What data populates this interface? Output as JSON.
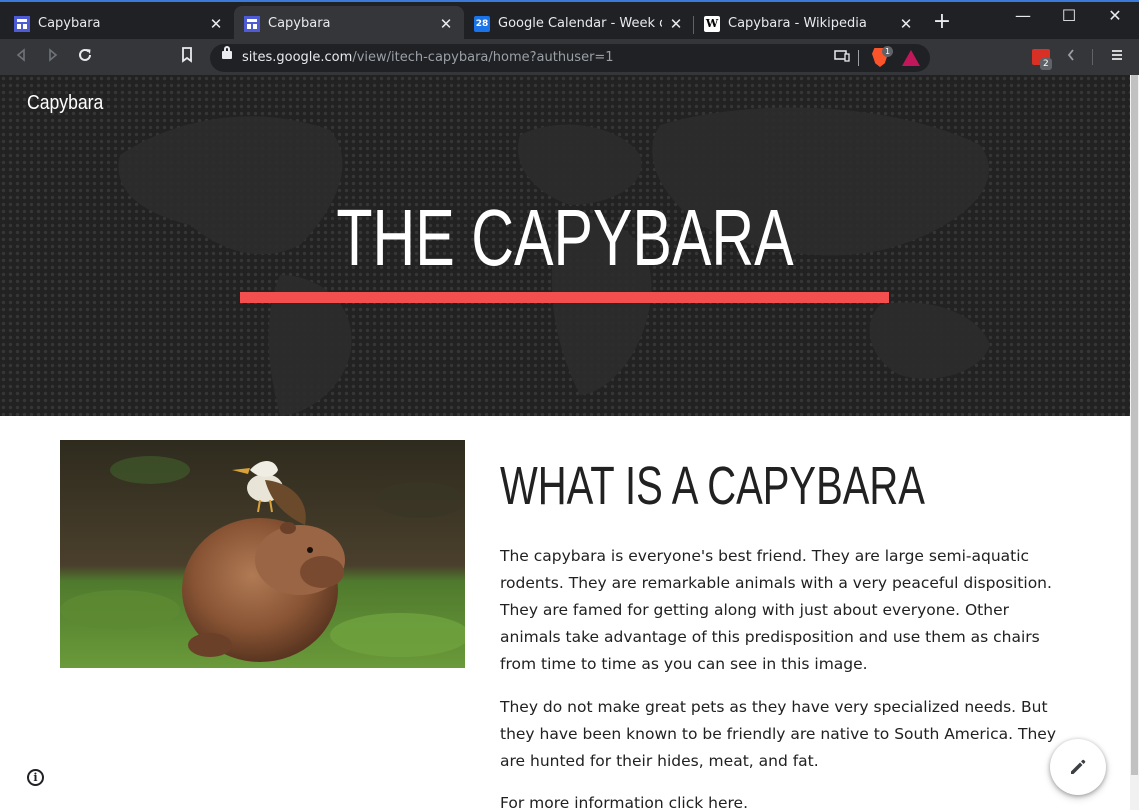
{
  "browser": {
    "tabs": [
      {
        "title": "Capybara",
        "favicon": "sites-icon",
        "active": false
      },
      {
        "title": "Capybara",
        "favicon": "sites-icon",
        "active": true
      },
      {
        "title": "Google Calendar - Week of Augu",
        "favicon": "calendar-icon",
        "favicon_text": "28",
        "active": false
      },
      {
        "title": "Capybara - Wikipedia",
        "favicon": "wikipedia-icon",
        "favicon_text": "W",
        "active": false
      }
    ],
    "close_glyph": "✕",
    "new_tab_glyph": "+",
    "window_controls": {
      "minimize": "—",
      "maximize": "☐",
      "close": "✕"
    },
    "address": {
      "host": "sites.google.com",
      "path": "/view/itech-capybara/home?authuser=1"
    },
    "brave_shield_count": "1",
    "extension_badge": "2",
    "colors": {
      "titlebar": "#202124",
      "toolbar": "#35363a",
      "accent": "#3b7ad8"
    }
  },
  "site": {
    "name": "Capybara",
    "hero": {
      "title": "THE CAPYBARA",
      "accent_color": "#f44f4f"
    },
    "section": {
      "title": "WHAT IS A CAPYBARA",
      "paragraphs": [
        "The capybara is everyone's best friend. They are large semi-aquatic rodents. They are remarkable animals with a very peaceful disposition. They are famed for getting along with just about everyone. Other animals take advantage of this predisposition and use them as chairs from time to time as you can see in this image.",
        "They do not make great pets as they have very specialized needs. But they have been known to be friendly are native to South America. They are hunted for their hides, meat, and fat.",
        "For more information click here."
      ]
    },
    "info_glyph": "i"
  }
}
